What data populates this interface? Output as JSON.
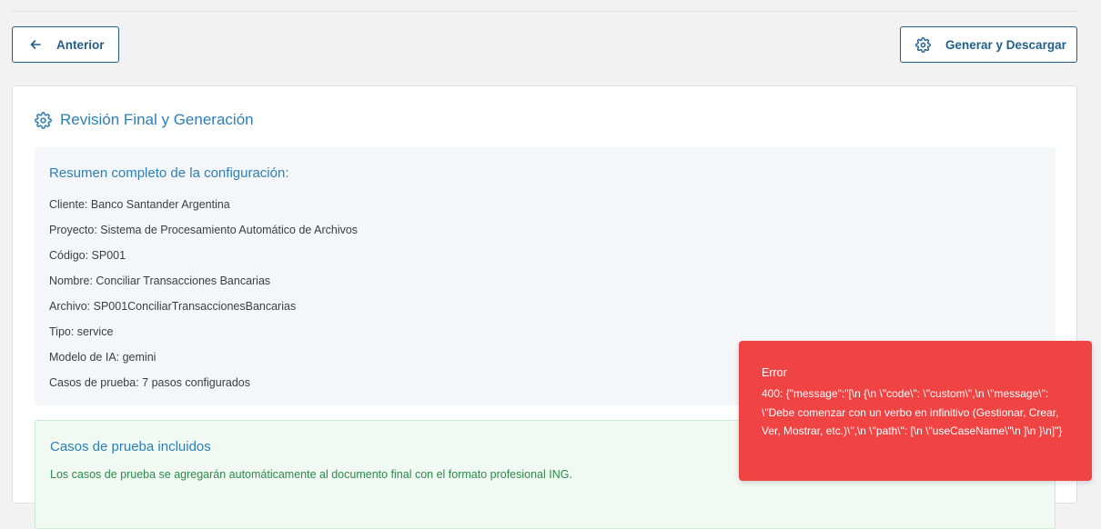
{
  "toolbar": {
    "prev_label": "Anterior",
    "generate_label": "Generar y Descargar",
    "prev_icon": "arrow-left-icon",
    "generate_icon": "gear-icon"
  },
  "card": {
    "title": "Revisión Final y Generación",
    "title_icon": "gear-icon"
  },
  "summary": {
    "title": "Resumen completo de la configuración:",
    "items": [
      "Cliente: Banco Santander Argentina",
      "Proyecto: Sistema de Procesamiento Automático de Archivos",
      "Código: SP001",
      "Nombre: Conciliar Transacciones Bancarias",
      "Archivo: SP001ConciliarTransaccionesBancarias",
      "Tipo: service",
      "Modelo de IA: gemini",
      "Casos de prueba: 7 pasos configurados"
    ]
  },
  "included": {
    "title": "Casos de prueba incluidos",
    "text": "Los casos de prueba se agregarán automáticamente al documento final con el formato profesional ING."
  },
  "toast": {
    "title": "Error",
    "message": "400: {\"message\":\"[\\n {\\n \\\"code\\\": \\\"custom\\\",\\n \\\"message\\\": \\\"Debe comenzar con un verbo en infinitivo (Gestionar, Crear, Ver, Mostrar, etc.)\\\",\\n \\\"path\\\": [\\n \\\"useCaseName\\\"\\n ]\\n }\\n]\"}"
  },
  "colors": {
    "accent": "#1f5f8b",
    "title_blue": "#2c7fb8",
    "success_text": "#2b8a4a",
    "error_bg": "#f04343"
  }
}
